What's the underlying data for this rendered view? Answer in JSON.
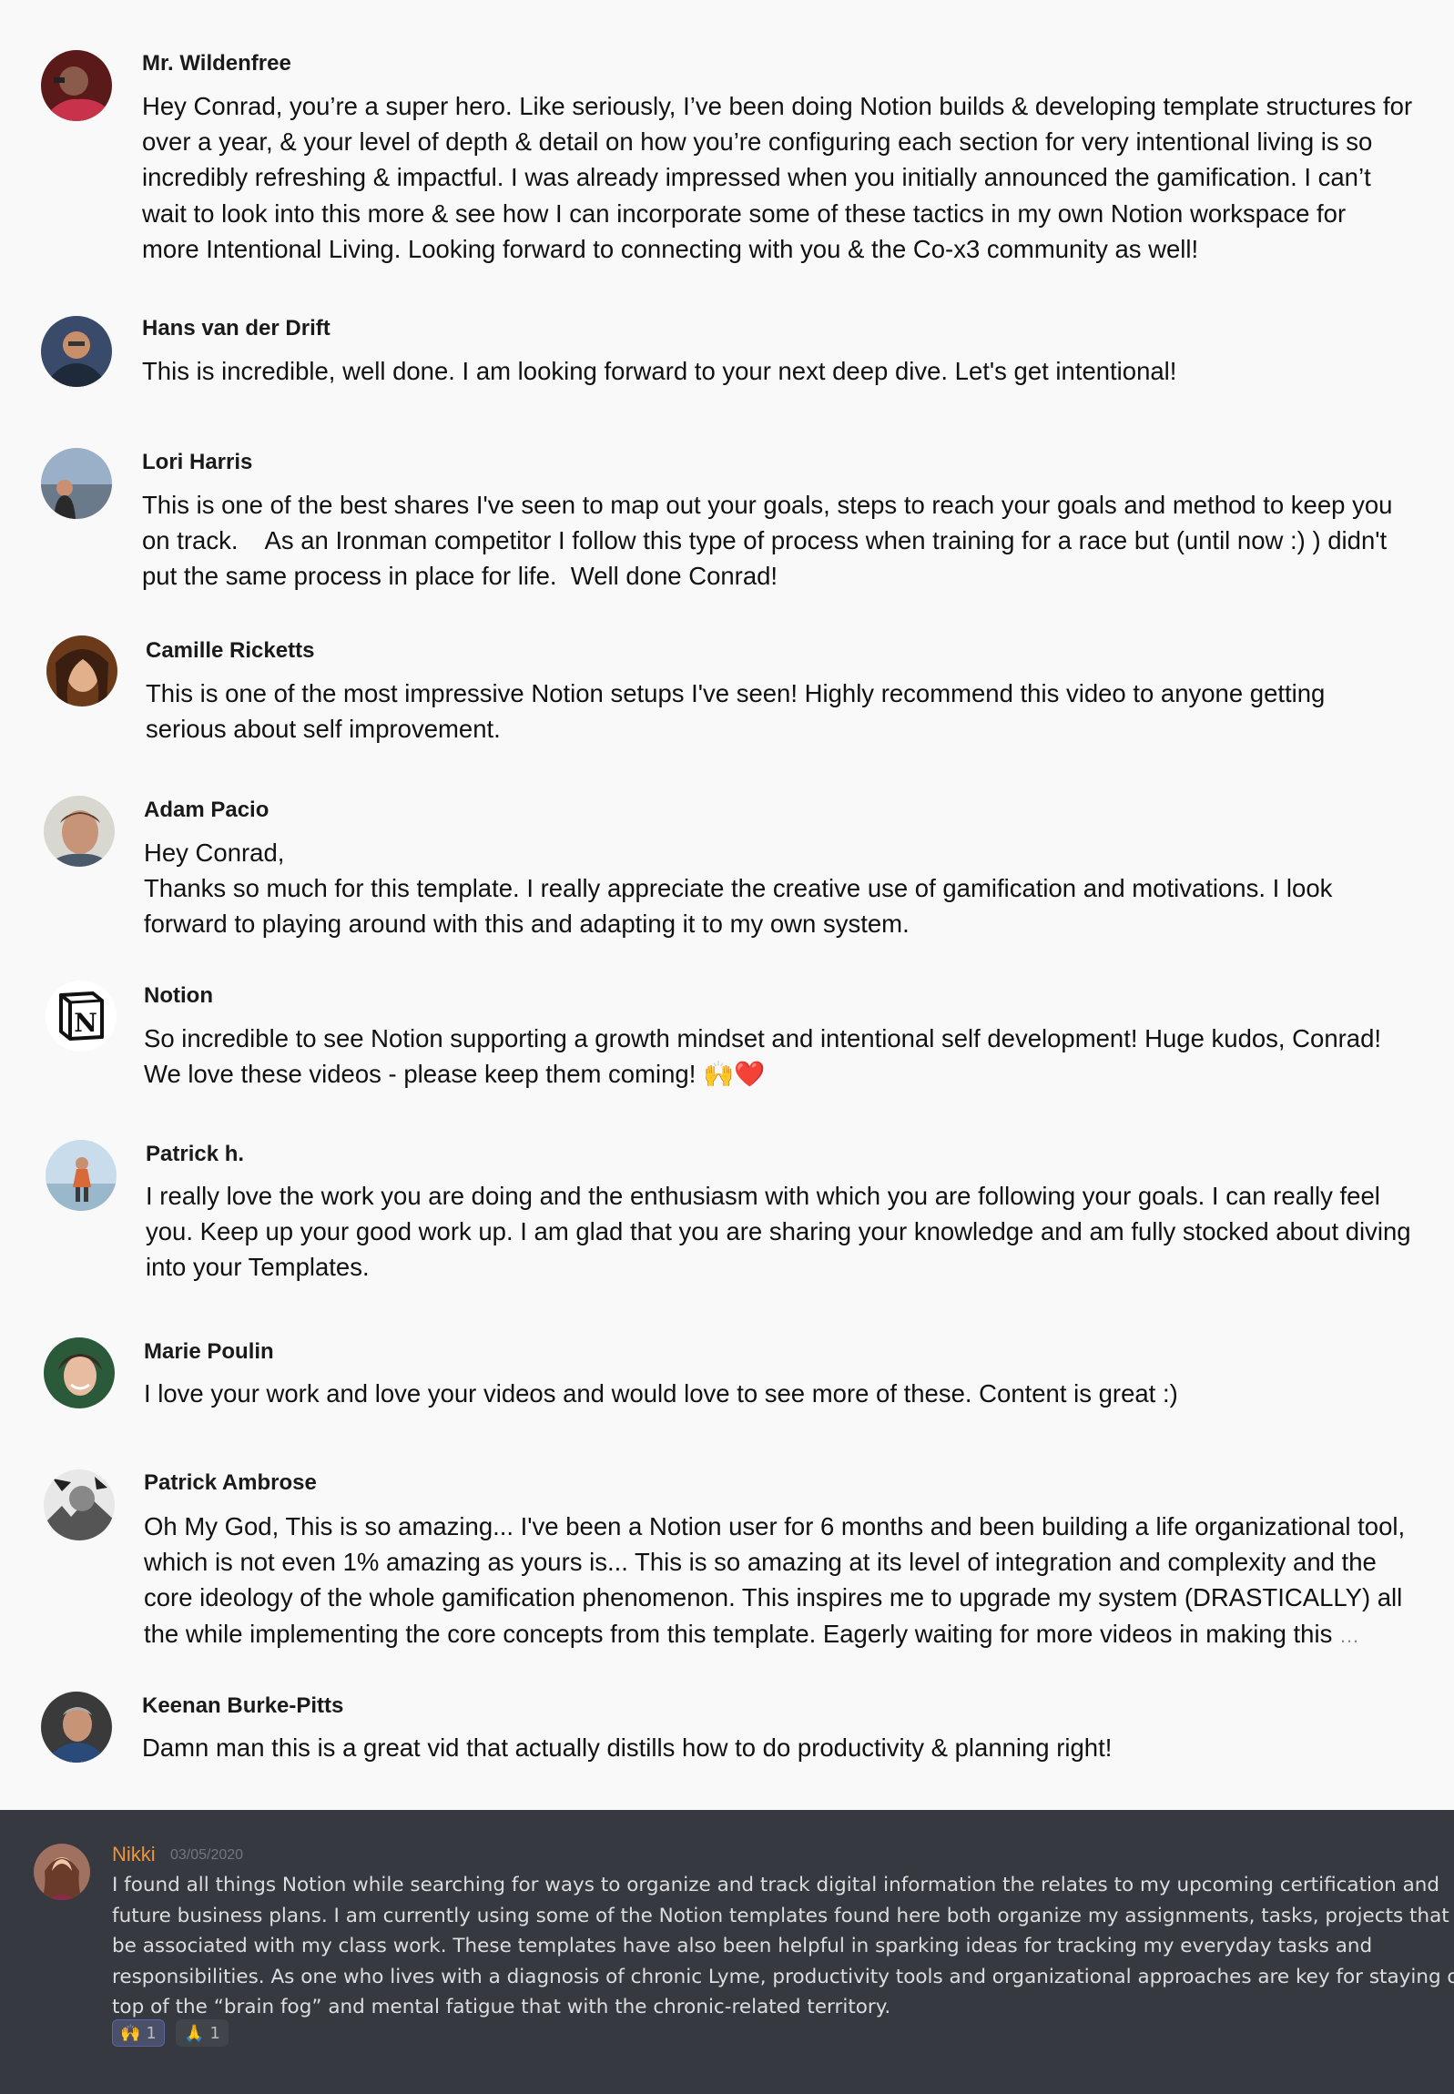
{
  "comments": [
    {
      "author": "Mr. Wildenfree",
      "avatar": "person-avatar-icon",
      "lines": [
        "Hey Conrad, you’re a super hero. Like seriously, I’ve been doing Notion builds & developing template structures for",
        "over a year, & your level of depth & detail on how you’re configuring each section for very intentional living is so",
        "incredibly refreshing & impactful. I was already impressed when you initially announced the gamification. I can’t",
        "wait to look into this more & see how I can incorporate some of these tactics in my own Notion workspace for",
        "more Intentional Living. Looking forward to connecting with you & the Co-x3 community as well!"
      ]
    },
    {
      "author": "Hans van der Drift",
      "avatar": "person-avatar-icon",
      "lines": [
        "This is incredible, well done. I am looking forward to your next deep dive. Let's get intentional!"
      ]
    },
    {
      "author": "Lori Harris",
      "avatar": "person-avatar-icon",
      "lines": [
        "This is one of the best shares I've seen to map out your goals, steps to reach your goals and method to keep you",
        "on track.    As an Ironman competitor I follow this type of process when training for a race but (until now :) ) didn't",
        "put the same process in place for life.  Well done Conrad!"
      ]
    },
    {
      "author": "Camille Ricketts",
      "avatar": "person-avatar-icon",
      "lines": [
        "This is one of the most impressive Notion setups I've seen! Highly recommend this video to anyone getting",
        "serious about self improvement."
      ]
    },
    {
      "author": "Adam Pacio",
      "avatar": "person-avatar-icon",
      "lines": [
        "Hey Conrad,",
        "Thanks so much for this template. I really appreciate the creative use of gamification and motivations. I look",
        "forward to playing around with this and adapting it to my own system."
      ]
    },
    {
      "author": "Notion",
      "avatar": "notion-logo-icon",
      "lines": [
        "So incredible to see Notion supporting a growth mindset and intentional self development! Huge kudos, Conrad!",
        "We love these videos - please keep them coming! 🙌❤️"
      ]
    },
    {
      "author": "Patrick h.",
      "avatar": "person-avatar-icon",
      "lines": [
        "I really love the work you are doing and the enthusiasm with which you are following your goals. I can really feel",
        "you. Keep up your good work up. I am glad that you are sharing your knowledge and am fully stocked about diving",
        "into your Templates."
      ]
    },
    {
      "author": "Marie Poulin",
      "avatar": "person-avatar-icon",
      "lines": [
        "I love your work and love your videos and would love to see more of these. Content is great :)"
      ]
    },
    {
      "author": "Patrick Ambrose",
      "avatar": "person-avatar-icon",
      "lines": [
        "Oh My God, This is so amazing... I've been a Notion user for 6 months and been building a life organizational tool,",
        "which is not even 1% amazing as yours is... This is so amazing at its level of integration and complexity and the",
        "core ideology of the whole gamification phenomenon.  This inspires me to upgrade my system (DRASTICALLY) all",
        "the while implementing the core concepts from this template. Eagerly waiting for more videos in making this"
      ],
      "more": "…"
    },
    {
      "author": "Keenan Burke-Pitts",
      "avatar": "person-avatar-icon",
      "lines": [
        "Damn man this is a great vid that actually distills how to do productivity & planning right!"
      ]
    }
  ],
  "chat": {
    "author": "Nikki",
    "date": "03/05/2020",
    "author_color": "#f0943c",
    "background": "#36393f",
    "lines": [
      "I found all things Notion while searching for ways to organize and track digital information the relates to my upcoming certification and",
      "future business plans. I am currently using some of the Notion templates found here both organize my assignments, tasks, projects that will",
      "be associated with my class work. These templates have also been helpful in sparking ideas for tracking my everyday tasks and",
      "responsibilities. As one who lives with a diagnosis of chronic Lyme, productivity tools and organizational approaches are key for staying on",
      "top of the “brain fog” and mental fatigue that with the chronic-related territory."
    ],
    "reactions": [
      {
        "emoji": "🙌",
        "count": "1"
      },
      {
        "emoji": "🙏",
        "count": "1"
      }
    ]
  }
}
